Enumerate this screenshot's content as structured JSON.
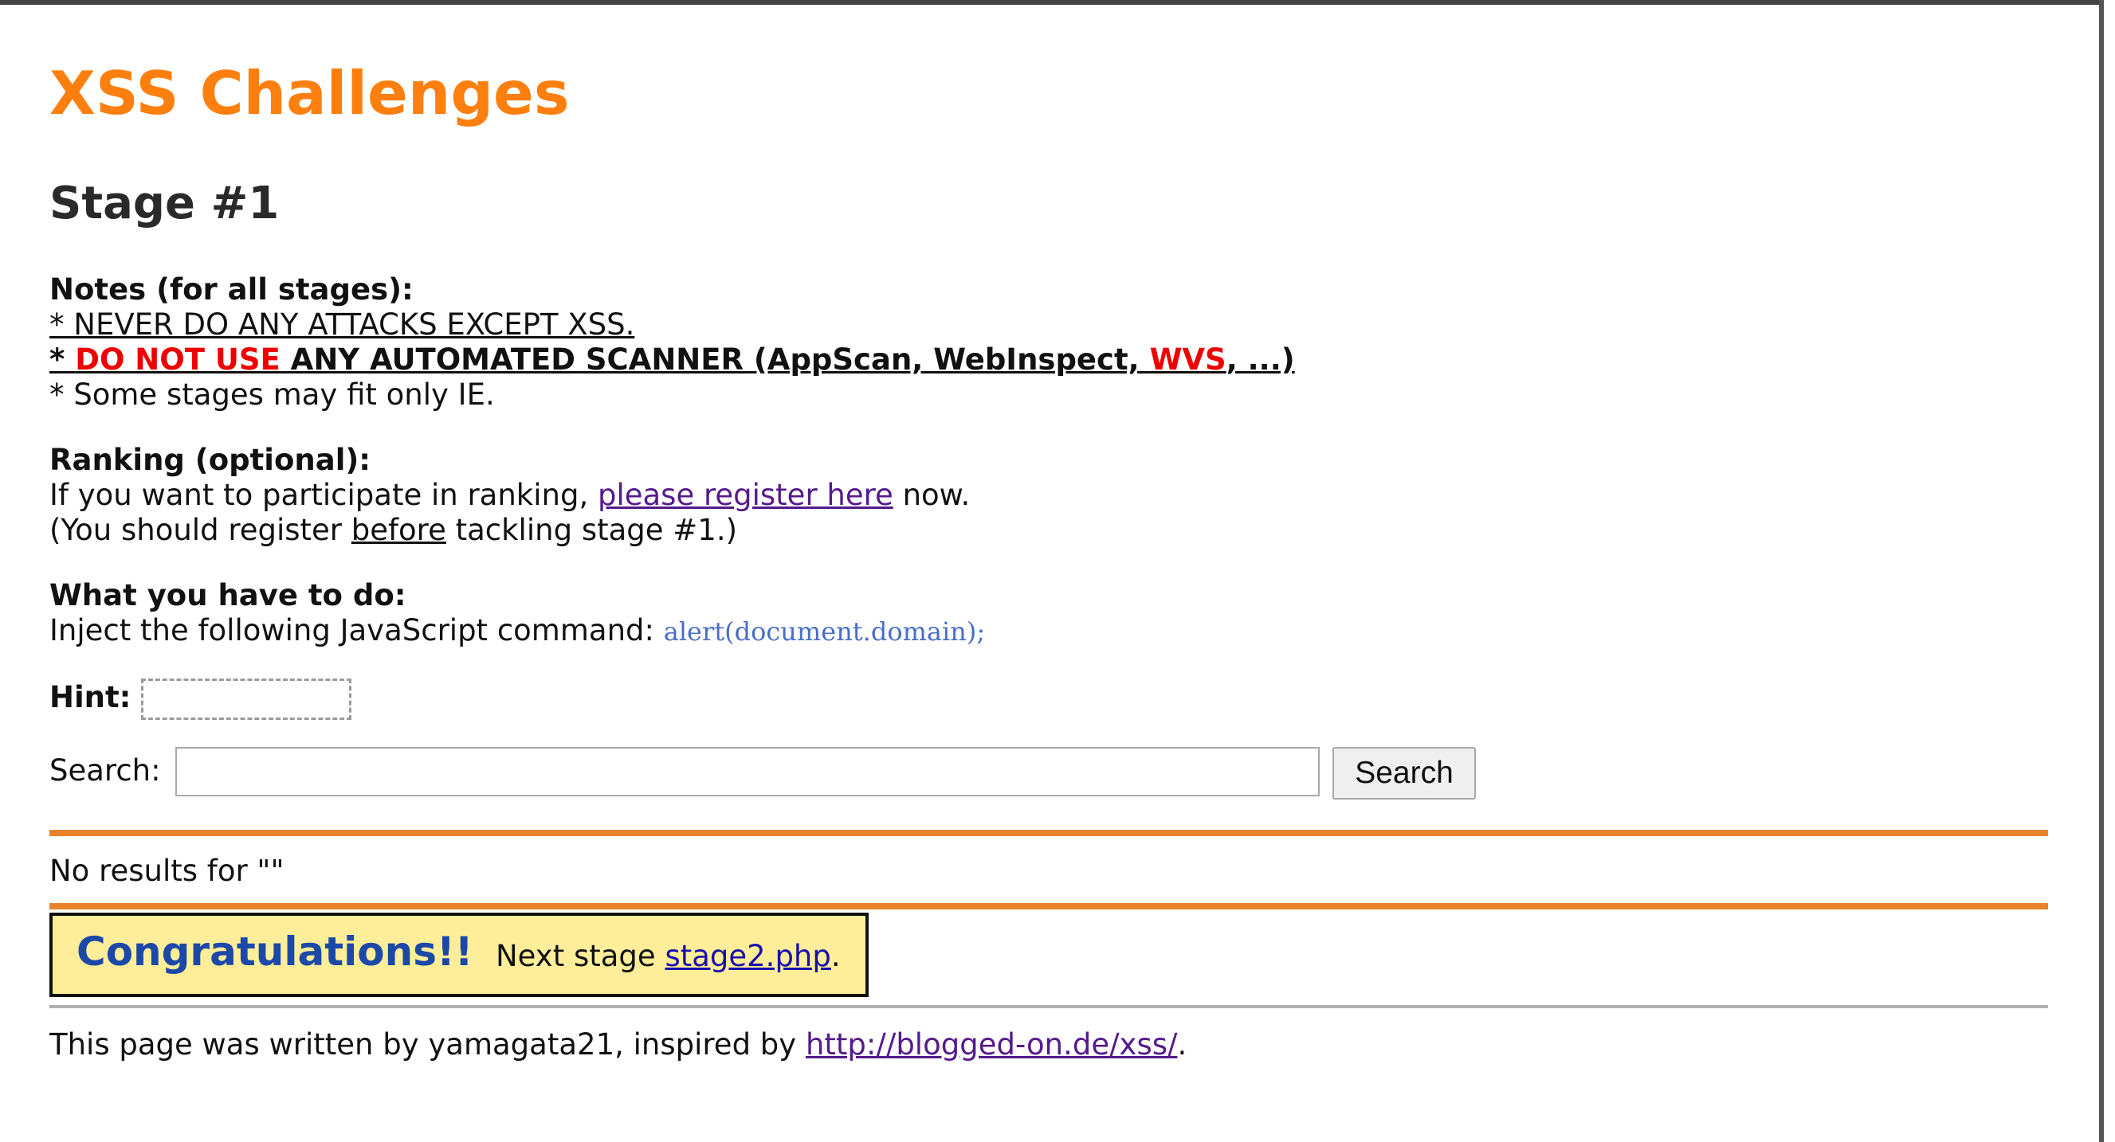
{
  "header": {
    "title": "XSS Challenges",
    "stage": "Stage #1"
  },
  "notes": {
    "heading": "Notes (for all stages):",
    "line1": "* NEVER DO ANY ATTACKS EXCEPT XSS.",
    "line2_star": "* ",
    "line2_red": "DO NOT USE",
    "line2_mid": " ANY AUTOMATED SCANNER (AppScan, WebInspect, ",
    "line2_wvs": "WVS",
    "line2_end": ", ...)",
    "line3": "* Some stages may fit only IE."
  },
  "ranking": {
    "heading": "Ranking (optional):",
    "line1_pre": "If you want to participate in ranking, ",
    "register_link": "please register here",
    "line1_post": " now.",
    "line2_pre": "(You should register ",
    "line2_before": "before",
    "line2_post": " tackling stage #1.)"
  },
  "task": {
    "heading": "What you have to do:",
    "line_pre": "Inject the following JavaScript command: ",
    "code": "alert(document.domain);"
  },
  "hint": {
    "label": "Hint:"
  },
  "search": {
    "label": "Search:",
    "value": "",
    "button_label": "Search"
  },
  "results": {
    "text": "No results for \"\""
  },
  "congrats": {
    "title": "Congratulations!!",
    "next_pre": "Next stage ",
    "next_link": "stage2.php",
    "next_post": "."
  },
  "footer": {
    "pre": "This page was written by yamagata21, inspired by ",
    "link": "http://blogged-on.de/xss/",
    "post": "."
  },
  "colors": {
    "title": "#ff7f0e",
    "warning_red": "#ee0000",
    "rule_orange": "#e8832a",
    "congrats_bg": "#ffee99",
    "congrats_title": "#1c48a8",
    "visited_link": "#551a8b",
    "code": "#4a6ec4"
  }
}
